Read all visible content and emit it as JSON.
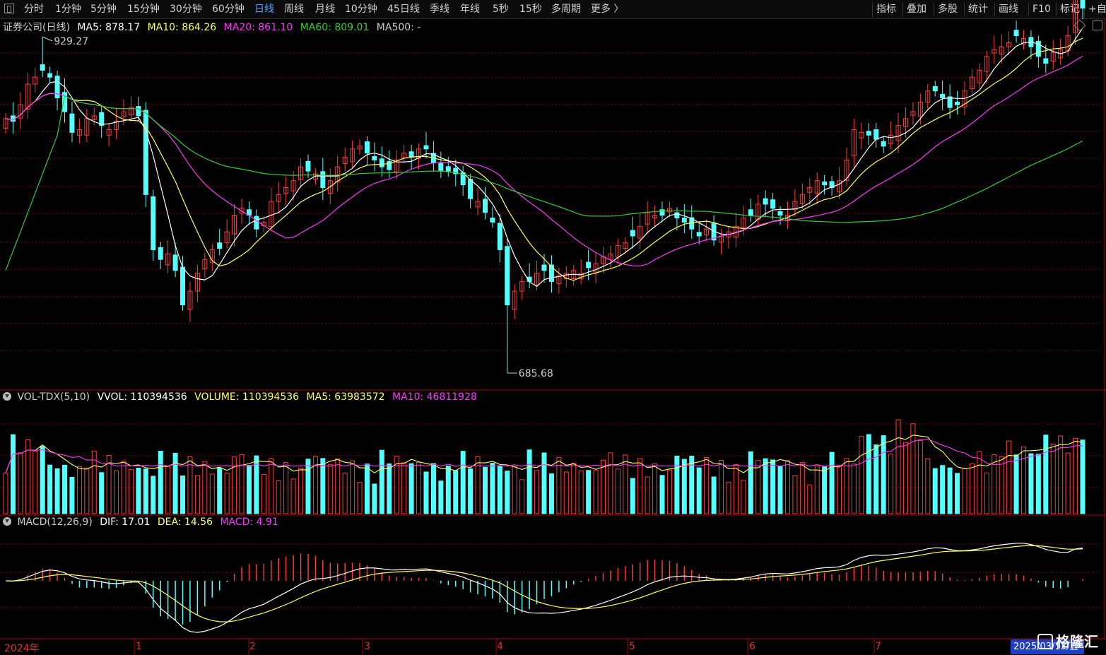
{
  "toolbar": {
    "periods": [
      "分时",
      "1分钟",
      "5分钟",
      "15分钟",
      "30分钟",
      "60分钟",
      "日线",
      "周线",
      "月线",
      "10分钟",
      "45日线",
      "季线",
      "年线",
      "5秒",
      "15秒",
      "多周期",
      "更多 〉"
    ],
    "active_index": 6,
    "tools": [
      "指标",
      "叠加",
      "多股",
      "统计",
      "画线",
      "F10",
      "标记",
      "+自"
    ]
  },
  "main_pane": {
    "title": "证券公司(日线)",
    "ma5_label": "MA5: 878.17",
    "ma10_label": "MA10: 864.26",
    "ma20_label": "MA20: 861.10",
    "ma60_label": "MA60: 809.01",
    "ma500_label": "MA500: -",
    "high_label": "929.27",
    "low_label": "685.68"
  },
  "vol_pane": {
    "title": "VOL-TDX(5,10)",
    "vvol_label": "VVOL: 110394536",
    "volume_label": "VOLUME: 110394536",
    "ma5_label": "MA5: 63983572",
    "ma10_label": "MA10: 46811928"
  },
  "macd_pane": {
    "title": "MACD(12,26,9)",
    "dif_label": "DIF: 17.01",
    "dea_label": "DEA: 14.56",
    "macd_label": "MACD: 4.91"
  },
  "x_axis": {
    "labels": [
      "2024年",
      "1",
      "2",
      "3",
      "4",
      "5",
      "6",
      "7"
    ],
    "current_date": "2025/03/13/五"
  },
  "watermark": "格隆汇",
  "colors": {
    "up": "#ff3b3b",
    "down": "#54ffff",
    "ma5": "#ffffff",
    "ma10": "#ffff55",
    "ma20": "#ff33ff",
    "ma60": "#33cc33",
    "grid": "#8a0000"
  },
  "chart_data": {
    "type": "candlestick",
    "price_range": [
      685.68,
      929.27
    ],
    "closes": [
      870,
      868,
      880,
      895,
      900,
      905,
      900,
      885,
      875,
      860,
      862,
      870,
      872,
      865,
      862,
      868,
      875,
      878,
      872,
      815,
      775,
      768,
      772,
      760,
      735,
      745,
      758,
      768,
      775,
      776,
      788,
      800,
      805,
      800,
      790,
      795,
      810,
      815,
      820,
      825,
      835,
      832,
      830,
      820,
      825,
      835,
      842,
      848,
      850,
      845,
      840,
      835,
      833,
      840,
      845,
      842,
      848,
      848,
      838,
      832,
      832,
      830,
      822,
      812,
      810,
      802,
      795,
      775,
      735,
      745,
      752,
      752,
      758,
      760,
      752,
      756,
      758,
      760,
      758,
      762,
      765,
      770,
      772,
      778,
      780,
      785,
      792,
      802,
      800,
      800,
      805,
      798,
      795,
      790,
      785,
      790,
      782,
      785,
      788,
      792,
      798,
      800,
      808,
      808,
      805,
      800,
      800,
      810,
      815,
      820,
      825,
      822,
      820,
      825,
      840,
      862,
      860,
      858,
      855,
      850,
      858,
      865,
      870,
      875,
      882,
      890,
      890,
      885,
      878,
      880,
      890,
      900,
      905,
      915,
      920,
      922,
      925,
      930,
      928,
      922,
      915,
      910,
      918,
      920,
      930,
      960,
      950
    ],
    "candle_colors": "up/down alternating per bar",
    "ma_series": [
      "MA5",
      "MA10",
      "MA20",
      "MA60"
    ]
  }
}
